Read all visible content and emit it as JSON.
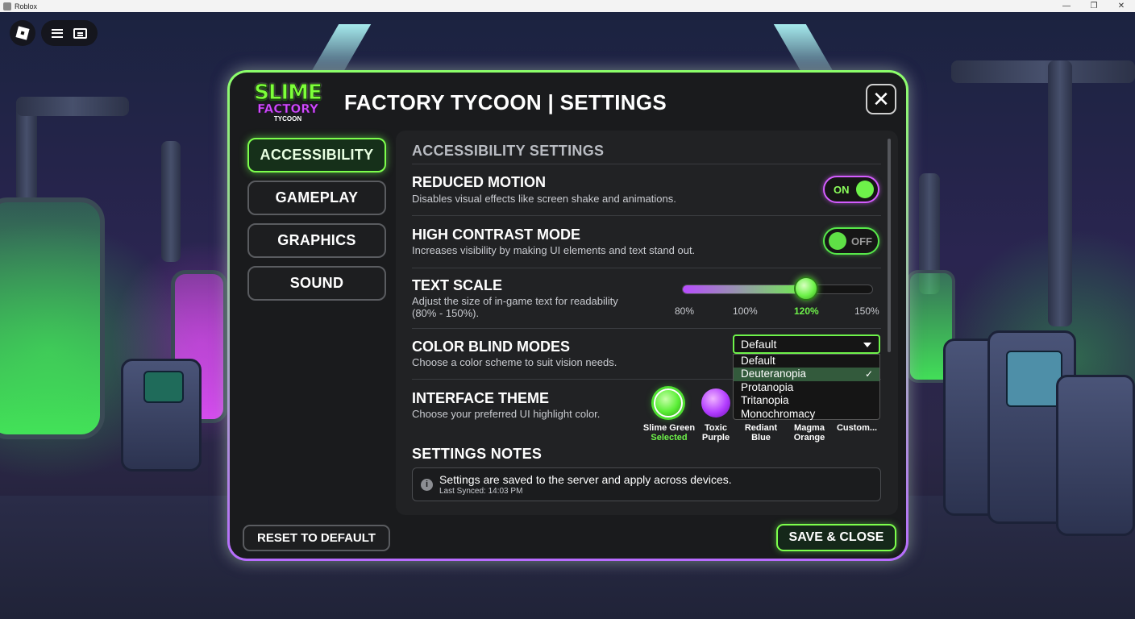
{
  "window": {
    "title": "Roblox",
    "minimize": "—",
    "maximize": "❐",
    "close": "✕"
  },
  "panel": {
    "logo": {
      "line1": "SLIME",
      "line2": "FACTORY",
      "line3": "TYCOON"
    },
    "title": "FACTORY TYCOON | SETTINGS",
    "close_glyph": "✕"
  },
  "tabs": [
    {
      "label": "ACCESSIBILITY",
      "active": true
    },
    {
      "label": "GAMEPLAY",
      "active": false
    },
    {
      "label": "GRAPHICS",
      "active": false
    },
    {
      "label": "SOUND",
      "active": false
    }
  ],
  "accessibility": {
    "heading": "ACCESSIBILITY SETTINGS",
    "reduced_motion": {
      "title": "REDUCED MOTION",
      "desc": "Disables visual effects like screen shake and animations.",
      "state": "ON"
    },
    "high_contrast": {
      "title": "HIGH CONTRAST MODE",
      "desc": "Increases visibility by making UI elements and text stand out.",
      "state": "OFF"
    },
    "text_scale": {
      "title": "TEXT SCALE",
      "desc_line1": "Adjust the size of in-game text for readability",
      "desc_line2": "(80% - 150%).",
      "value_percent": 120,
      "ticks": [
        "80%",
        "100%",
        "120%",
        "150%"
      ]
    },
    "color_blind": {
      "title": "COLOR BLIND MODES",
      "desc": "Choose a color scheme to suit vision needs.",
      "selected_display": "Default",
      "options": [
        "Default",
        "Deuteranopia",
        "Protanopia",
        "Tritanopia",
        "Monochromacy"
      ],
      "highlighted": "Deuteranopia",
      "check_glyph": "✓"
    },
    "interface_theme": {
      "title": "INTERFACE THEME",
      "desc": "Choose your preferred UI highlight color.",
      "themes": [
        {
          "line1": "Slime Green",
          "line2": "Selected",
          "color": "#5bef37"
        },
        {
          "line1": "Toxic",
          "line2": "Purple",
          "color": "#b23cff"
        },
        {
          "line1": "Rediant",
          "line2": "Blue"
        },
        {
          "line1": "Magma",
          "line2": "Orange"
        },
        {
          "line1": "Custom...",
          "line2": ""
        }
      ]
    },
    "notes": {
      "heading": "SETTINGS NOTES",
      "info_glyph": "i",
      "main": "Settings are saved to the server and apply across devices.",
      "sub": "Last Synced: 14:03 PM"
    }
  },
  "footer": {
    "reset_label": "RESET TO DEFAULT",
    "save_label": "SAVE & CLOSE"
  },
  "colors": {
    "accent_green": "#6ef24a",
    "accent_purple": "#d45cff",
    "panel_bg": "#1a1b1d"
  }
}
